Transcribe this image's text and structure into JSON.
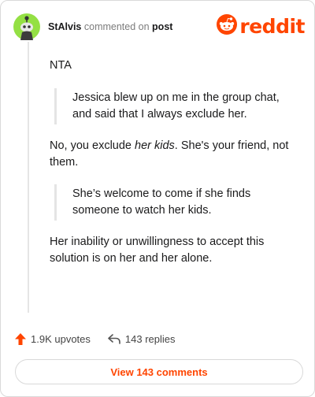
{
  "comment": {
    "username": "StAlvis",
    "action": "commented on",
    "target": "post",
    "logo_text": "reddit",
    "paragraphs": {
      "p1": "NTA",
      "quote1": "Jessica blew up on me in the group chat, and said that I always exclude her.",
      "p2_before": "No, you exclude ",
      "p2_em": "her kids",
      "p2_after": ". She's your friend, not them.",
      "quote2": "She’s welcome to come if she finds someone to watch her kids.",
      "p3": "Her inability or unwillingness to accept this solution is on her and her alone."
    }
  },
  "footer": {
    "upvotes": "1.9K upvotes",
    "replies": "143 replies",
    "view_button": "View 143 comments"
  },
  "icons": {
    "avatar": "snoo-avatar-icon",
    "logo": "reddit-logo-icon",
    "upvote": "upvote-arrow-icon",
    "reply": "reply-arrow-icon"
  },
  "colors": {
    "brand": "#ff4500",
    "avatar_bg": "#94e044",
    "muted_text": "#7c7c7c",
    "quote_border": "#e4e4e4"
  }
}
